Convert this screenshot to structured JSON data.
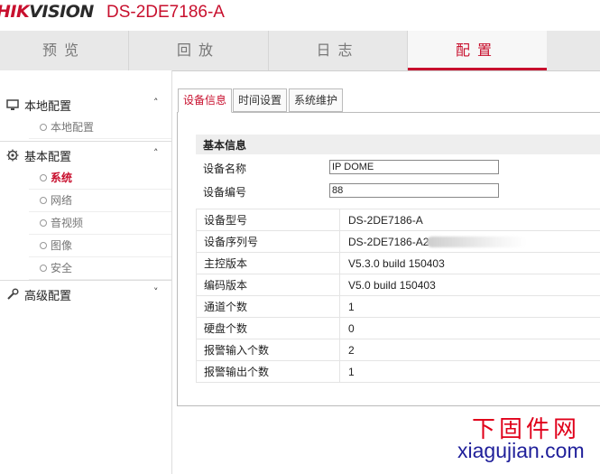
{
  "header": {
    "brand_red": "HIK",
    "brand_dark": "VISION",
    "model": "DS-2DE7186-A"
  },
  "nav": {
    "items": [
      {
        "label": "预览"
      },
      {
        "label": "回放"
      },
      {
        "label": "日志"
      },
      {
        "label": "配置"
      }
    ],
    "active_index": 3
  },
  "sidebar": {
    "local": {
      "label": "本地配置",
      "items": [
        {
          "label": "本地配置"
        }
      ]
    },
    "basic": {
      "label": "基本配置",
      "items": [
        {
          "label": "系统"
        },
        {
          "label": "网络"
        },
        {
          "label": "音视频"
        },
        {
          "label": "图像"
        },
        {
          "label": "安全"
        }
      ]
    },
    "advanced": {
      "label": "高级配置"
    }
  },
  "tabs": [
    {
      "label": "设备信息"
    },
    {
      "label": "时间设置"
    },
    {
      "label": "系统维护"
    }
  ],
  "basic_info": {
    "title": "基本信息",
    "device_name_label": "设备名称",
    "device_name_value": "IP DOME",
    "device_no_label": "设备编号",
    "device_no_value": "88"
  },
  "info_table": [
    {
      "key": "设备型号",
      "value": "DS-2DE7186-A"
    },
    {
      "key": "设备序列号",
      "value": "DS-2DE7186-A2"
    },
    {
      "key": "主控版本",
      "value": "V5.3.0 build 150403"
    },
    {
      "key": "编码版本",
      "value": "V5.0 build 150403"
    },
    {
      "key": "通道个数",
      "value": "1"
    },
    {
      "key": "硬盘个数",
      "value": "0"
    },
    {
      "key": "报警输入个数",
      "value": "2"
    },
    {
      "key": "报警输出个数",
      "value": "1"
    }
  ],
  "watermark": {
    "cn": "下固件网",
    "en": "xiagujian.com"
  },
  "colors": {
    "accent": "#c8102e",
    "watermark_cn": "#e0001a",
    "watermark_en": "#1f1f9a"
  }
}
